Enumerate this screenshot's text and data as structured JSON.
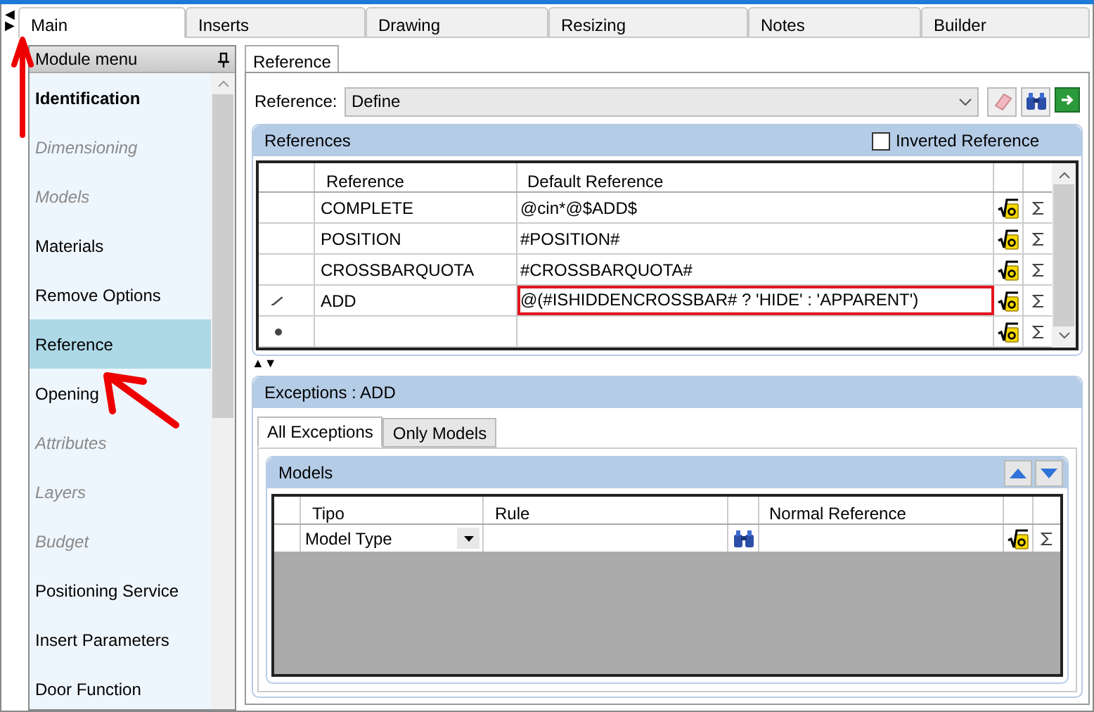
{
  "nav_arrows": [
    "◀",
    "▶"
  ],
  "tabs": [
    {
      "label": "Main",
      "selected": true
    },
    {
      "label": "Inserts",
      "selected": false
    },
    {
      "label": "Drawing",
      "selected": false
    },
    {
      "label": "Resizing",
      "selected": false
    },
    {
      "label": "Notes",
      "selected": false
    },
    {
      "label": "Builder",
      "selected": false
    }
  ],
  "sidebar": {
    "title": "Module menu",
    "items": [
      {
        "label": "Identification",
        "bold": true,
        "disabled": false,
        "selected": false
      },
      {
        "label": "Dimensioning",
        "bold": false,
        "disabled": true,
        "selected": false
      },
      {
        "label": "Models",
        "bold": false,
        "disabled": true,
        "selected": false
      },
      {
        "label": "Materials",
        "bold": false,
        "disabled": false,
        "selected": false
      },
      {
        "label": "Remove Options",
        "bold": false,
        "disabled": false,
        "selected": false
      },
      {
        "label": "Reference",
        "bold": false,
        "disabled": false,
        "selected": true
      },
      {
        "label": "Opening",
        "bold": false,
        "disabled": false,
        "selected": false
      },
      {
        "label": "Attributes",
        "bold": false,
        "disabled": true,
        "selected": false
      },
      {
        "label": "Layers",
        "bold": false,
        "disabled": true,
        "selected": false
      },
      {
        "label": "Budget",
        "bold": false,
        "disabled": true,
        "selected": false
      },
      {
        "label": "Positioning Service",
        "bold": false,
        "disabled": false,
        "selected": false
      },
      {
        "label": "Insert Parameters",
        "bold": false,
        "disabled": false,
        "selected": false
      },
      {
        "label": "Door Function",
        "bold": false,
        "disabled": false,
        "selected": false
      }
    ]
  },
  "panel_tab": {
    "label": "Reference",
    "selected": true
  },
  "reference_field": {
    "label": "Reference:",
    "value": "Define"
  },
  "references": {
    "title": "References",
    "inverted": {
      "label": "Inverted Reference",
      "checked": false
    },
    "columns": [
      "Reference",
      "Default Reference"
    ],
    "rows": [
      {
        "kind": "row",
        "reference": "COMPLETE",
        "default": "@cin*@$ADD$",
        "highlighted": false
      },
      {
        "kind": "row",
        "reference": "POSITION",
        "default": "#POSITION#",
        "highlighted": false
      },
      {
        "kind": "row",
        "reference": "CROSSBARQUOTA",
        "default": "#CROSSBARQUOTA#",
        "highlighted": false
      },
      {
        "kind": "edit",
        "reference": "ADD",
        "default": "@(#ISHIDDENCROSSBAR# ? 'HIDE' : 'APPARENT')",
        "highlighted": true
      },
      {
        "kind": "new",
        "reference": "",
        "default": "",
        "highlighted": false
      }
    ],
    "sort_arrows": "▲▼"
  },
  "exceptions": {
    "title": "Exceptions : ADD",
    "tabs": [
      {
        "label": "All Exceptions",
        "selected": true
      },
      {
        "label": "Only Models",
        "selected": false
      }
    ],
    "models": {
      "title": "Models",
      "columns": [
        "Tipo",
        "Rule",
        "Normal Reference"
      ],
      "rows": [
        {
          "tipo": "Model Type"
        }
      ]
    }
  }
}
